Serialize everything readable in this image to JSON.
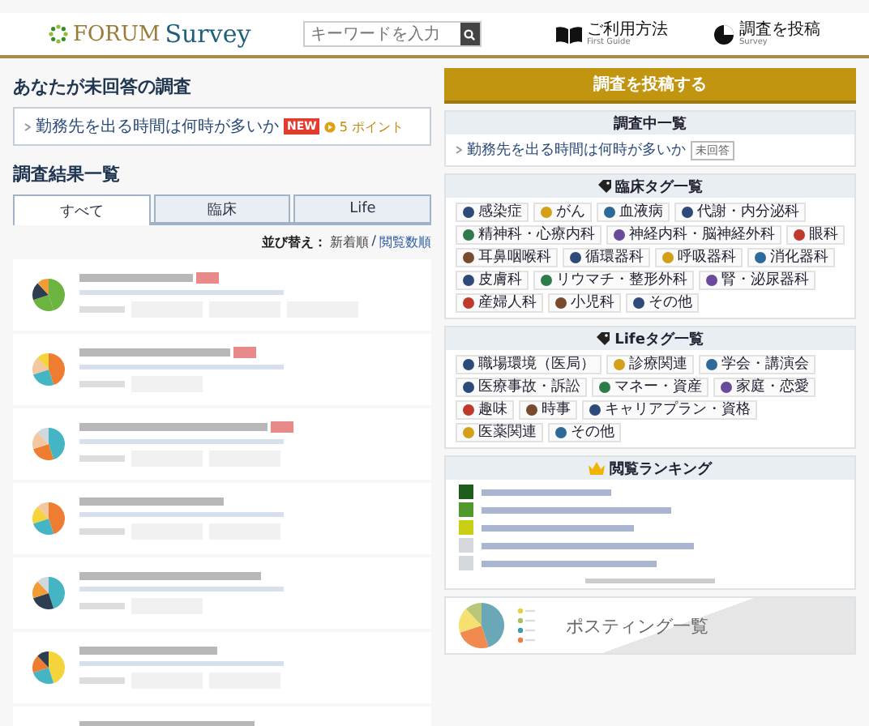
{
  "header": {
    "logo": {
      "brand": "FORUM",
      "product": "Survey"
    },
    "search": {
      "placeholder": "キーワードを入力"
    },
    "nav": [
      {
        "kind": "book",
        "label": "ご利用方法",
        "sub": "First Guide"
      },
      {
        "kind": "pie",
        "label": "調査を投稿",
        "sub": "Survey"
      }
    ]
  },
  "unanswered": {
    "title": "あなたが未回答の調査",
    "items": [
      {
        "text": "勤務先を出る時間は何時が多いか",
        "badge": "NEW",
        "points": "5 ポイント"
      }
    ]
  },
  "results": {
    "title": "調査結果一覧",
    "tabs": [
      {
        "label": "すべて",
        "selected": true
      },
      {
        "label": "臨床",
        "selected": false
      },
      {
        "label": "Life",
        "selected": false
      }
    ],
    "sort": {
      "label": "並び替え：",
      "separator": "/",
      "options": [
        {
          "label": "新着順",
          "selected": true
        },
        {
          "label": "閲覧数順",
          "selected": false
        }
      ]
    },
    "rows": [
      {
        "new": true
      },
      {
        "new": true
      },
      {
        "new": true
      },
      {
        "new": false
      },
      {
        "new": false
      },
      {
        "new": false
      },
      {
        "new": false
      }
    ]
  },
  "sidebar": {
    "post_button": "調査を投稿する",
    "ongoing": {
      "title": "調査中一覧",
      "items": [
        {
          "text": "勤務先を出る時間は何時が多いか",
          "badge": "未回答"
        }
      ]
    },
    "clinical_tags": {
      "title": "臨床タグ一覧",
      "tags": [
        "感染症",
        "がん",
        "血液病",
        "代謝・内分泌科",
        "精神科・心療内科",
        "神経内科・脳神経外科",
        "眼科",
        "耳鼻咽喉科",
        "循環器科",
        "呼吸器科",
        "消化器科",
        "皮膚科",
        "リウマチ・整形外科",
        "腎・泌尿器科",
        "産婦人科",
        "小児科",
        "その他"
      ]
    },
    "life_tags": {
      "title": "Lifeタグ一覧",
      "tags": [
        "職場環境（医局）",
        "診療関連",
        "学会・講演会",
        "医療事故・訴訟",
        "マネー・資産",
        "家庭・恋愛",
        "趣味",
        "時事",
        "キャリアプラン・資格",
        "医薬関連",
        "その他"
      ]
    },
    "ranking": {
      "title": "閲覧ランキング",
      "items": [
        {
          "color": "#1d5e1d"
        },
        {
          "color": "#4f9a2a"
        },
        {
          "color": "#c9cf14"
        },
        {
          "color": "#d4d8dd"
        },
        {
          "color": "#d4d8dd"
        }
      ]
    },
    "posting": {
      "title": "ポスティング一覧"
    }
  }
}
